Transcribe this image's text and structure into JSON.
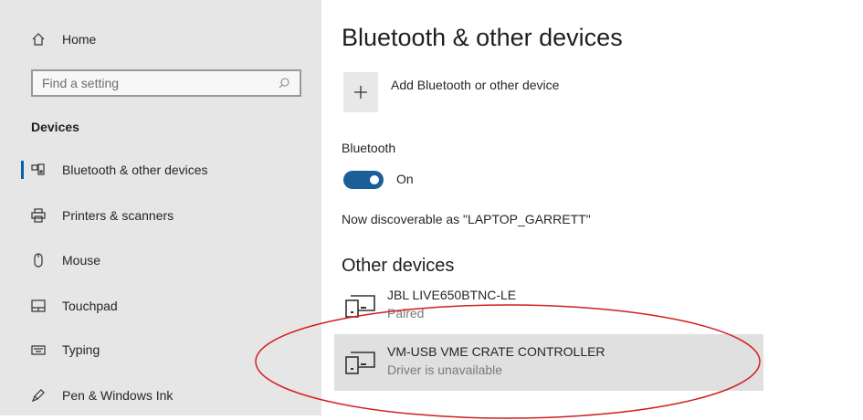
{
  "sidebar": {
    "home_label": "Home",
    "search_placeholder": "Find a setting",
    "section_label": "Devices",
    "items": [
      {
        "label": "Bluetooth & other devices",
        "icon": "bluetooth-devices-icon",
        "active": true
      },
      {
        "label": "Printers & scanners",
        "icon": "printer-icon"
      },
      {
        "label": "Mouse",
        "icon": "mouse-icon"
      },
      {
        "label": "Touchpad",
        "icon": "touchpad-icon"
      },
      {
        "label": "Typing",
        "icon": "keyboard-icon"
      },
      {
        "label": "Pen & Windows Ink",
        "icon": "pen-icon"
      }
    ]
  },
  "main": {
    "title": "Bluetooth & other devices",
    "add_device_label": "Add Bluetooth or other device",
    "bluetooth_heading": "Bluetooth",
    "bluetooth_toggle_label": "On",
    "discoverable_text": "Now discoverable as \"LAPTOP_GARRETT\"",
    "other_devices_heading": "Other devices",
    "devices": [
      {
        "name": "JBL LIVE650BTNC-LE",
        "status": "Paired"
      },
      {
        "name": "VM-USB VME CRATE CONTROLLER",
        "status": "Driver is unavailable",
        "selected": true
      }
    ]
  },
  "colors": {
    "accent": "#0063b1",
    "toggle_on": "#1a5f98",
    "sidebar_bg": "#e6e6e6",
    "annotation": "#d21f1f"
  }
}
